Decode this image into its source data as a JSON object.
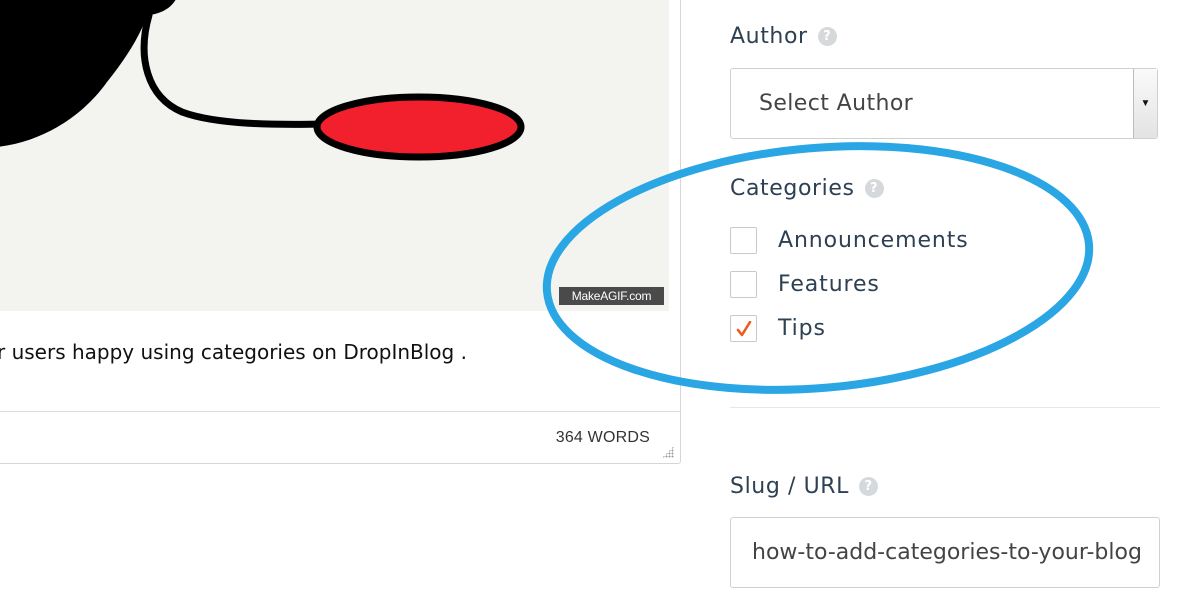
{
  "editor": {
    "watermark": "MakeAGIF.com",
    "body_text": "r users happy using categories on DropInBlog .",
    "word_count": "364 WORDS"
  },
  "sidebar": {
    "author": {
      "label": "Author",
      "help_icon": "question-circle-icon",
      "selected": "Select Author"
    },
    "categories": {
      "label": "Categories",
      "help_icon": "question-circle-icon",
      "items": [
        {
          "label": "Announcements",
          "checked": false
        },
        {
          "label": "Features",
          "checked": false
        },
        {
          "label": "Tips",
          "checked": true
        }
      ]
    },
    "slug": {
      "label": "Slug / URL",
      "help_icon": "question-circle-icon",
      "value": "how-to-add-categories-to-your-blog"
    }
  },
  "colors": {
    "annotation_ellipse": "#2aa6e4",
    "checkmark": "#f05a1e",
    "text": "#2e4053"
  }
}
